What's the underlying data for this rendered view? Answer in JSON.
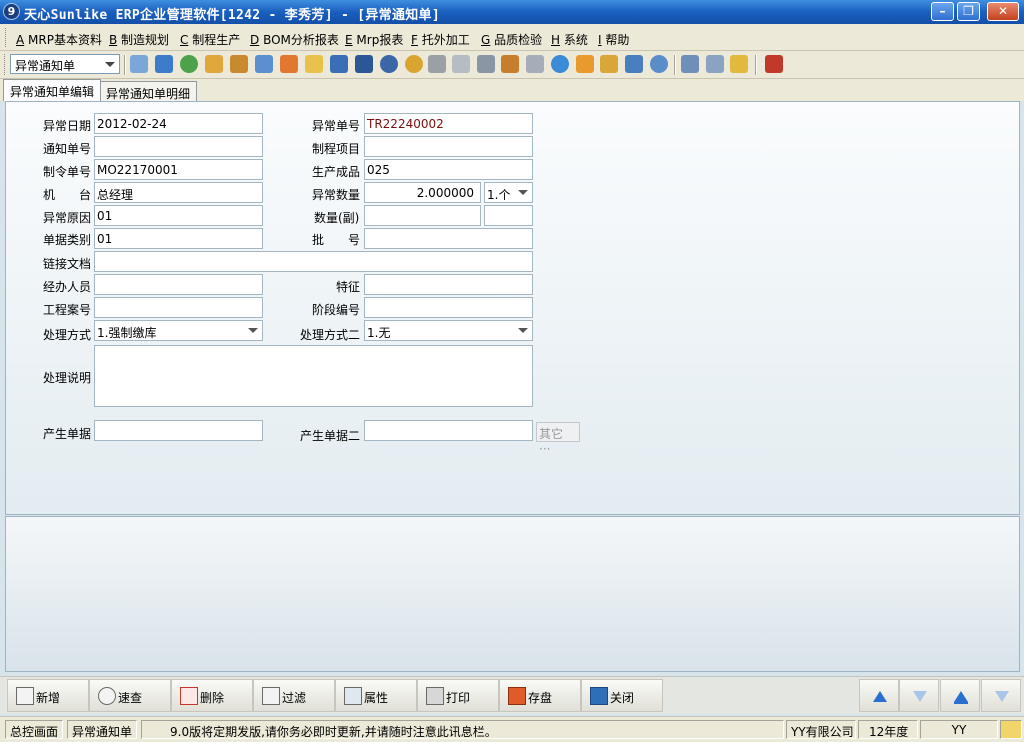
{
  "window": {
    "title": "天心Sunlike ERP企业管理软件[1242 - 李秀芳] - [异常通知单]",
    "app_icon": "9"
  },
  "menu": [
    {
      "key": "A",
      "label": " MRP基本资料"
    },
    {
      "key": "B",
      "label": " 制造规划"
    },
    {
      "key": "C",
      "label": " 制程生产"
    },
    {
      "key": "D",
      "label": " BOM分析报表"
    },
    {
      "key": "E",
      "label": " Mrp报表"
    },
    {
      "key": "F",
      "label": " 托外加工"
    },
    {
      "key": "G",
      "label": " 品质检验"
    },
    {
      "key": "H",
      "label": " 系统"
    },
    {
      "key": "I",
      "label": " 帮助"
    }
  ],
  "toolbar": {
    "selector_value": "异常通知单"
  },
  "tabs": [
    {
      "label": "异常通知单编辑",
      "active": true
    },
    {
      "label": "异常通知单明细",
      "active": false
    }
  ],
  "form": {
    "date_label": "异常日期",
    "date_value": "2012-02-24",
    "no_label": "异常单号",
    "no_value": "TR22240002",
    "notice_label": "通知单号",
    "notice_value": "",
    "item_label": "制程项目",
    "item_value": "",
    "mo_label": "制令单号",
    "mo_value": "MO22170001",
    "product_label": "生产成品",
    "product_value": "025",
    "machine_label": "机　　台",
    "machine_value": "总经理",
    "qty_label": "异常数量",
    "qty_value": "2.000000",
    "unit_value": "1.个",
    "reason_label": "异常原因",
    "reason_value": "01",
    "qty2_label": "数量(副)",
    "qty2_value": "",
    "unit2_value": "",
    "doctype_label": "单据类别",
    "doctype_value": "01",
    "batch_label": "批　　号",
    "batch_value": "",
    "link_label": "链接文档",
    "link_value": "",
    "handler_label": "经办人员",
    "handler_value": "",
    "feature_label": "特征",
    "feature_value": "",
    "project_label": "工程案号",
    "project_value": "",
    "stage_label": "阶段编号",
    "stage_value": "",
    "method_label": "处理方式",
    "method_value": "1.强制缴库",
    "method2_label": "处理方式二",
    "method2_value": "1.无",
    "desc_label": "处理说明",
    "desc_value": "",
    "gen_label": "产生单据",
    "gen_value": "",
    "gen2_label": "产生单据二",
    "gen2_value": "",
    "other_label": "其它 ···"
  },
  "buttons": [
    {
      "label": "新增",
      "icon": "add-icon"
    },
    {
      "label": "速查",
      "icon": "search-icon"
    },
    {
      "label": "删除",
      "icon": "delete-icon"
    },
    {
      "label": "过滤",
      "icon": "filter-icon"
    },
    {
      "label": "属性",
      "icon": "properties-icon"
    },
    {
      "label": "打印",
      "icon": "printer-icon"
    },
    {
      "label": "存盘",
      "icon": "save-icon"
    },
    {
      "label": "关闭",
      "icon": "close-icon"
    }
  ],
  "status": {
    "home": "总控画面",
    "current": "异常通知单",
    "message": "9.0版将定期发版,请你务必即时更新,并请随时注意此讯息栏。",
    "company": "YY有限公司",
    "year": "12年度",
    "user": "YY"
  }
}
